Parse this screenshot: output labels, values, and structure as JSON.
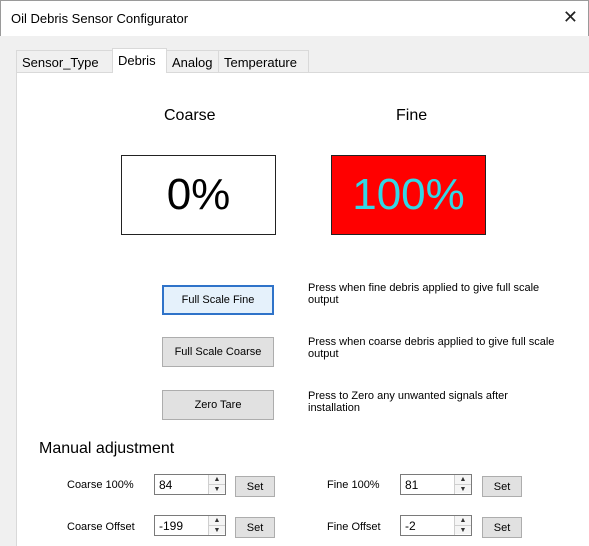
{
  "window": {
    "title": "Oil Debris Sensor Configurator",
    "close_glyph": "✕"
  },
  "tabs": [
    {
      "label": "Sensor_Type"
    },
    {
      "label": "Debris"
    },
    {
      "label": "Analog"
    },
    {
      "label": "Temperature"
    }
  ],
  "active_tab": "Debris",
  "coarse": {
    "heading": "Coarse",
    "value": "0%",
    "text_color": "#000000",
    "bg_color": "#ffffff"
  },
  "fine": {
    "heading": "Fine",
    "value": "100%",
    "text_color": "#32d7e6",
    "bg_color": "#ff0000"
  },
  "buttons": {
    "full_scale_fine": {
      "label": "Full Scale Fine",
      "note": "Press when fine debris applied to give full scale output"
    },
    "full_scale_coarse": {
      "label": "Full Scale Coarse",
      "note": "Press when coarse debris applied to give full scale output"
    },
    "zero_tare": {
      "label": "Zero Tare",
      "note": "Press to Zero any unwanted signals after installation"
    }
  },
  "manual": {
    "title": "Manual adjustment",
    "coarse_100": {
      "label": "Coarse 100%",
      "value": "84",
      "set_label": "Set"
    },
    "coarse_offset": {
      "label": "Coarse Offset",
      "value": "-199",
      "set_label": "Set"
    },
    "fine_100": {
      "label": "Fine 100%",
      "value": "81",
      "set_label": "Set"
    },
    "fine_offset": {
      "label": "Fine Offset",
      "value": "-2",
      "set_label": "Set"
    }
  },
  "icons": {
    "spin_up": "▲",
    "spin_down": "▼"
  }
}
